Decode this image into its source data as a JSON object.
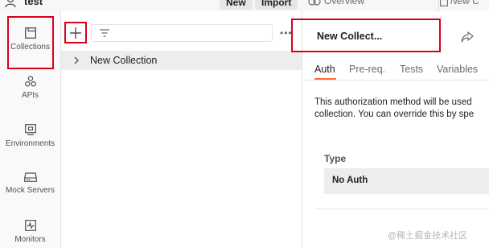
{
  "topbar": {
    "workspace_name": "test",
    "new_label": "New",
    "import_label": "Import",
    "tabs": [
      {
        "label": "Overview",
        "icon": "overview-icon"
      },
      {
        "label": "New C",
        "icon": "collection-tab-icon"
      }
    ]
  },
  "sidebar": {
    "items": [
      {
        "label": "Collections",
        "icon": "collections-icon",
        "active": true
      },
      {
        "label": "APIs",
        "icon": "apis-icon"
      },
      {
        "label": "Environments",
        "icon": "environments-icon"
      },
      {
        "label": "Mock Servers",
        "icon": "mock-servers-icon"
      },
      {
        "label": "Monitors",
        "icon": "monitors-icon"
      }
    ]
  },
  "collections_panel": {
    "add_icon": "plus-icon",
    "filter_icon": "filter-icon",
    "more_label": "•••",
    "items": [
      {
        "label": "New Collection",
        "icon": "chevron-right-icon"
      }
    ]
  },
  "detail": {
    "title": "New Collect...",
    "share_icon": "share-icon",
    "tabs": [
      {
        "label": "Auth",
        "active": true
      },
      {
        "label": "Pre-req."
      },
      {
        "label": "Tests"
      },
      {
        "label": "Variables"
      }
    ],
    "description_line1": "This authorization method will be used",
    "description_line2": "collection. You can override this by spe",
    "type_label": "Type",
    "type_value": "No Auth"
  },
  "watermark": "@稀土掘金技术社区",
  "colors": {
    "annotation_red": "#d9001b",
    "accent_orange": "#ff6c37",
    "rail_bg": "#f9f9f9",
    "selected_row_bg": "#ededed"
  }
}
